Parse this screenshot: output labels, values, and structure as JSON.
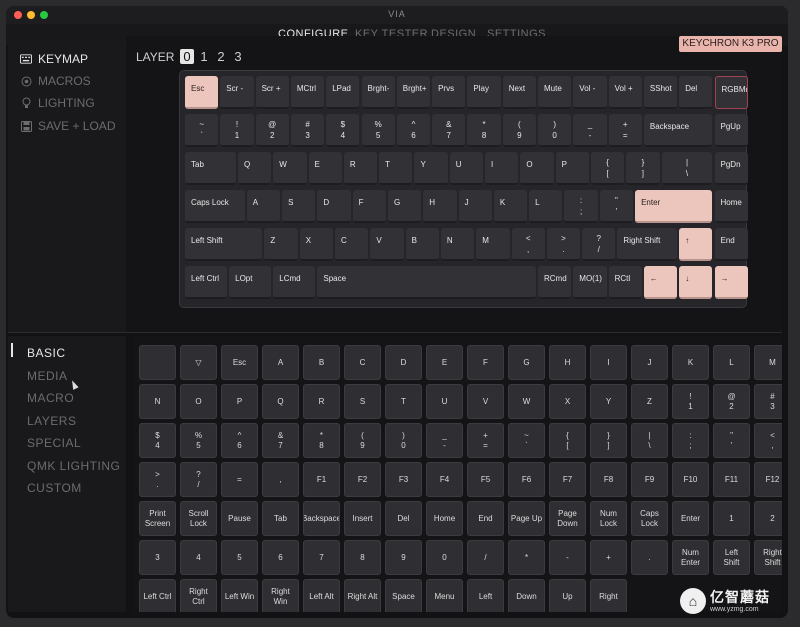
{
  "window": {
    "title": "VIA"
  },
  "nav": {
    "items": [
      "CONFIGURE",
      "KEY TESTER",
      "DESIGN",
      "SETTINGS"
    ],
    "active": "CONFIGURE"
  },
  "sidebar": {
    "items": [
      {
        "label": "KEYMAP",
        "icon": "keyboard-icon",
        "active": true
      },
      {
        "label": "MACROS",
        "icon": "macro-circle-icon",
        "active": false
      },
      {
        "label": "LIGHTING",
        "icon": "lightbulb-icon",
        "active": false
      },
      {
        "label": "SAVE + LOAD",
        "icon": "save-disk-icon",
        "active": false
      }
    ]
  },
  "layer": {
    "label": "LAYER",
    "options": [
      "0",
      "1",
      "2",
      "3"
    ],
    "selected": "0"
  },
  "keyboard": {
    "name": "KEYCHRON K3 PRO",
    "rows": [
      [
        "Esc",
        "Scr -",
        "Scr +",
        "MCtrl",
        "LPad",
        "Brght-",
        "Brght+",
        "Prvs",
        "Play",
        "Next",
        "Mute",
        "Vol -",
        "Vol +",
        "SShot",
        "Del",
        "RGBMd+"
      ],
      [
        "~\n`",
        "!\n1",
        "@\n2",
        "#\n3",
        "$\n4",
        "%\n5",
        "^\n6",
        "&\n7",
        "*\n8",
        "(\n9",
        ")\n0",
        "_\n-",
        "+\n=",
        "Backspace",
        "PgUp"
      ],
      [
        "Tab",
        "Q",
        "W",
        "E",
        "R",
        "T",
        "Y",
        "U",
        "I",
        "O",
        "P",
        "{\n[",
        "}\n]",
        "|\n\\",
        "PgDn"
      ],
      [
        "Caps Lock",
        "A",
        "S",
        "D",
        "F",
        "G",
        "H",
        "J",
        "K",
        "L",
        ":\n;",
        "\"\n'",
        "Enter",
        "Home"
      ],
      [
        "Left Shift",
        "Z",
        "X",
        "C",
        "V",
        "B",
        "N",
        "M",
        "<\n,",
        ">\n.",
        "?\n/",
        "Right Shift",
        "↑",
        "End"
      ],
      [
        "Left Ctrl",
        "LOpt",
        "LCmd",
        "Space",
        "RCmd",
        "MO(1)",
        "RCtl",
        "←",
        "↓",
        "→"
      ]
    ]
  },
  "categories": {
    "items": [
      "BASIC",
      "MEDIA",
      "MACRO",
      "LAYERS",
      "SPECIAL",
      "QMK LIGHTING",
      "CUSTOM"
    ],
    "active": "BASIC"
  },
  "keycodes": {
    "rows": [
      [
        "",
        "▽",
        "Esc",
        "A",
        "B",
        "C",
        "D",
        "E",
        "F",
        "G",
        "H",
        "I",
        "J",
        "K",
        "L",
        "M"
      ],
      [
        "N",
        "O",
        "P",
        "Q",
        "R",
        "S",
        "T",
        "U",
        "V",
        "W",
        "X",
        "Y",
        "Z",
        "!\n1",
        "@\n2",
        "#\n3"
      ],
      [
        "$\n4",
        "%\n5",
        "^\n6",
        "&\n7",
        "*\n8",
        "(\n9",
        ")\n0",
        "_\n-",
        "+\n=",
        "~\n`",
        "{\n[",
        "}\n]",
        "|\n\\",
        ":\n;",
        "\"\n'",
        "<\n,"
      ],
      [
        ">\n.",
        "?\n/",
        "=",
        ",",
        "F1",
        "F2",
        "F3",
        "F4",
        "F5",
        "F6",
        "F7",
        "F8",
        "F9",
        "F10",
        "F11",
        "F12"
      ],
      [
        "Print\nScreen",
        "Scroll\nLock",
        "Pause",
        "Tab",
        "Backspace",
        "Insert",
        "Del",
        "Home",
        "End",
        "Page Up",
        "Page\nDown",
        "Num\nLock",
        "Caps\nLock",
        "Enter",
        "1",
        "2"
      ],
      [
        "3",
        "4",
        "5",
        "6",
        "7",
        "8",
        "9",
        "0",
        "/",
        "*",
        "-",
        "+",
        ".",
        "Num\nEnter",
        "Left\nShift",
        "Right\nShift"
      ],
      [
        "Left Ctrl",
        "Right\nCtrl",
        "Left Win",
        "Right\nWin",
        "Left Alt",
        "Right Alt",
        "Space",
        "Menu",
        "Left",
        "Down",
        "Up",
        "Right"
      ]
    ]
  },
  "watermark": {
    "text": "亿智蘑菇",
    "url": "www.yzmg.com",
    "logo": "mushroom-logo-icon"
  }
}
